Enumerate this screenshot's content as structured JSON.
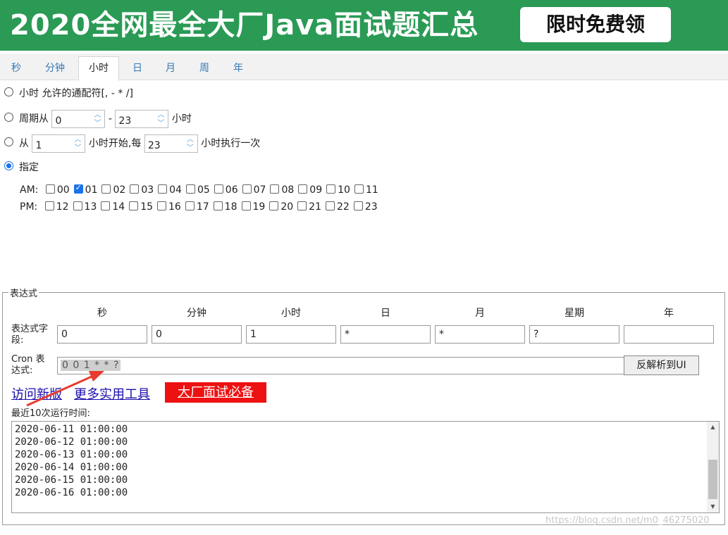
{
  "banner": {
    "title": "2020全网最全大厂Java面试题汇总",
    "button": "限时免费领"
  },
  "tabs": [
    "秒",
    "分钟",
    "小时",
    "日",
    "月",
    "周",
    "年"
  ],
  "active_tab": "小时",
  "hour_options": {
    "opt1": "小时 允许的通配符[, - * /]",
    "opt2_prefix": "周期从",
    "opt2_from": "0",
    "opt2_dash": "-",
    "opt2_to": "23",
    "opt2_suffix": "小时",
    "opt3_prefix": "从",
    "opt3_start": "1",
    "opt3_mid": "小时开始,每",
    "opt3_every": "23",
    "opt3_suffix": "小时执行一次",
    "opt4": "指定",
    "selected": "指定"
  },
  "am_label": "AM:",
  "pm_label": "PM:",
  "am_hours": [
    "00",
    "01",
    "02",
    "03",
    "04",
    "05",
    "06",
    "07",
    "08",
    "09",
    "10",
    "11"
  ],
  "pm_hours": [
    "12",
    "13",
    "14",
    "15",
    "16",
    "17",
    "18",
    "19",
    "20",
    "21",
    "22",
    "23"
  ],
  "checked_hours": [
    "01"
  ],
  "expression": {
    "legend": "表达式",
    "columns": [
      "秒",
      "分钟",
      "小时",
      "日",
      "月",
      "星期",
      "年"
    ],
    "field_label": "表达式字段:",
    "values": [
      "0",
      "0",
      "1",
      "*",
      "*",
      "?",
      ""
    ],
    "cron_label": "Cron 表达式:",
    "cron_value": "0 0 1 * * ?",
    "parse_button": "反解析到UI"
  },
  "links": {
    "new_version": "访问新版",
    "more_tools": "更多实用工具",
    "interview": "大厂面试必备"
  },
  "run_label": "最近10次运行时间:",
  "run_times": [
    "2020-06-11 01:00:00",
    "2020-06-12 01:00:00",
    "2020-06-13 01:00:00",
    "2020-06-14 01:00:00",
    "2020-06-15 01:00:00",
    "2020-06-16 01:00:00"
  ],
  "watermark": "https://blog.csdn.net/m0_46275020",
  "colors": {
    "banner": "#2a9a55",
    "accent": "#1a73e8",
    "link": "#1a0dab",
    "red_button": "#ee1111"
  }
}
